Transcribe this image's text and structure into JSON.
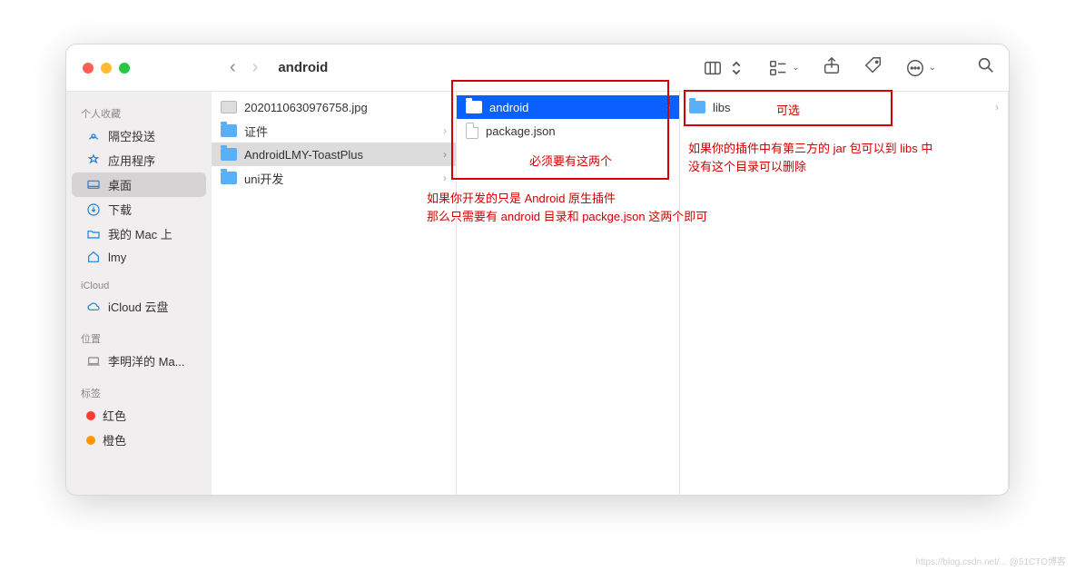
{
  "window": {
    "title": "android"
  },
  "sidebar": {
    "sections": {
      "favorites": {
        "header": "个人收藏",
        "items": [
          {
            "label": "隔空投送"
          },
          {
            "label": "应用程序"
          },
          {
            "label": "桌面"
          },
          {
            "label": "下载"
          },
          {
            "label": "我的 Mac 上"
          },
          {
            "label": "lmy"
          }
        ]
      },
      "icloud": {
        "header": "iCloud",
        "items": [
          {
            "label": "iCloud 云盘"
          }
        ]
      },
      "locations": {
        "header": "位置",
        "items": [
          {
            "label": "李明洋的 Ma..."
          }
        ]
      },
      "tags": {
        "header": "标签",
        "items": [
          {
            "label": "红色",
            "color": "#ff3b30"
          },
          {
            "label": "橙色",
            "color": "#ff9500"
          }
        ]
      }
    }
  },
  "columns": {
    "c1": [
      {
        "kind": "image",
        "label": "2020110630976758.jpg"
      },
      {
        "kind": "folder",
        "label": "证件",
        "has_children": true
      },
      {
        "kind": "folder",
        "label": "AndroidLMY-ToastPlus",
        "has_children": true,
        "selected": "grey"
      },
      {
        "kind": "folder",
        "label": "uni开发",
        "has_children": true
      }
    ],
    "c2": [
      {
        "kind": "folder",
        "label": "android",
        "has_children": true,
        "selected": "blue"
      },
      {
        "kind": "file",
        "label": "package.json"
      }
    ],
    "c3": [
      {
        "kind": "folder",
        "label": "libs",
        "has_children": true
      }
    ]
  },
  "annotations": {
    "inside_box1": "必须要有这两个",
    "below_box1_line1": "如果你开发的只是 Android 原生插件",
    "below_box1_line2": "那么只需要有 android 目录和 packge.json 这两个即可",
    "inside_box2": "可选",
    "below_box2_line1": "如果你的插件中有第三方的 jar 包可以到 libs 中",
    "below_box2_line2": "没有这个目录可以删除"
  },
  "watermark": "https://blog.csdn.net/... @51CTO博客"
}
